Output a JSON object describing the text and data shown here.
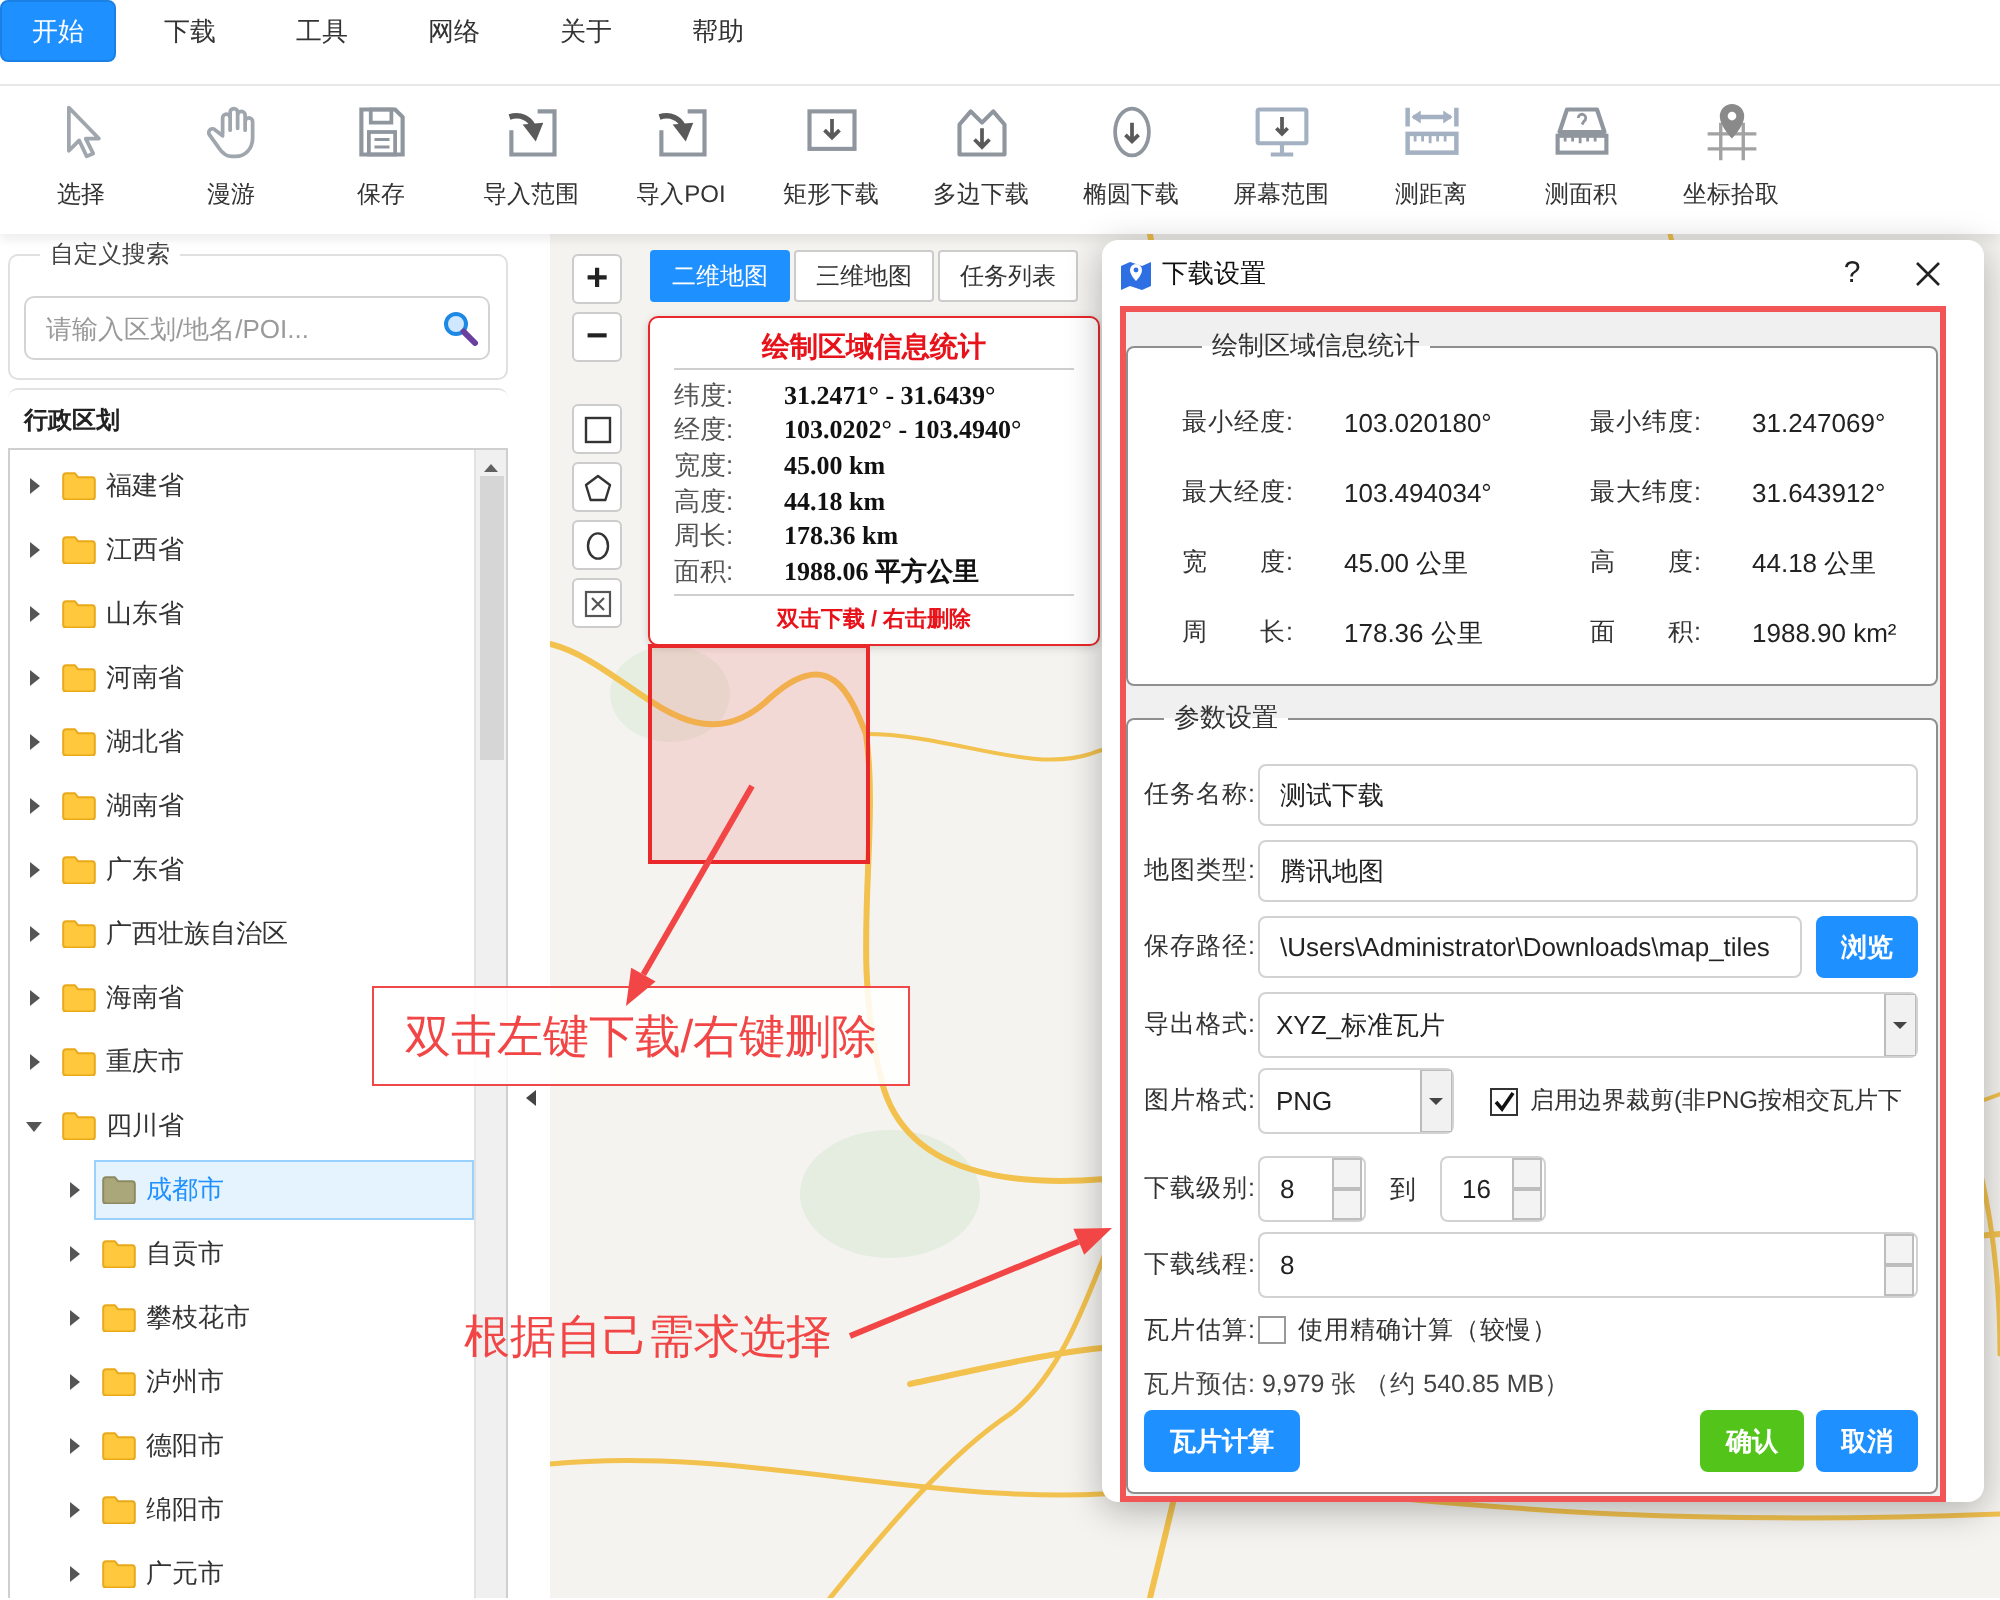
{
  "menu_tabs": [
    {
      "label": "开始",
      "selected": true
    },
    {
      "label": "下载",
      "selected": false
    },
    {
      "label": "工具",
      "selected": false
    },
    {
      "label": "网络",
      "selected": false
    },
    {
      "label": "关于",
      "selected": false
    },
    {
      "label": "帮助",
      "selected": false
    }
  ],
  "toolbar": [
    {
      "kind": "select",
      "label": "选择"
    },
    {
      "kind": "pan",
      "label": "漫游"
    },
    {
      "kind": "save",
      "label": "保存"
    },
    {
      "kind": "import",
      "label": "导入范围"
    },
    {
      "kind": "import",
      "label": "导入POI"
    },
    {
      "kind": "rectangle",
      "label": "矩形下载"
    },
    {
      "kind": "polygon",
      "label": "多边下载"
    },
    {
      "kind": "ellipse",
      "label": "椭圆下载"
    },
    {
      "kind": "screen",
      "label": "屏幕范围"
    },
    {
      "kind": "distance",
      "label": "测距离"
    },
    {
      "kind": "area",
      "label": "测面积"
    },
    {
      "kind": "coordinate",
      "label": "坐标拾取"
    }
  ],
  "sidebar": {
    "search_legend": "自定义搜索",
    "search": {
      "placeholder": "请输入区划/地名/POI..."
    },
    "tree_title": "行政区划",
    "tree": [
      {
        "label": "福建省",
        "expanded": false,
        "selected": false
      },
      {
        "label": "江西省",
        "expanded": false,
        "selected": false
      },
      {
        "label": "山东省",
        "expanded": false,
        "selected": false
      },
      {
        "label": "河南省",
        "expanded": false,
        "selected": false
      },
      {
        "label": "湖北省",
        "expanded": false,
        "selected": false
      },
      {
        "label": "湖南省",
        "expanded": false,
        "selected": false
      },
      {
        "label": "广东省",
        "expanded": false,
        "selected": false
      },
      {
        "label": "广西壮族自治区",
        "expanded": false,
        "selected": false
      },
      {
        "label": "海南省",
        "expanded": false,
        "selected": false
      },
      {
        "label": "重庆市",
        "expanded": false,
        "selected": false
      },
      {
        "label": "四川省",
        "expanded": true,
        "selected": false,
        "children": [
          {
            "label": "成都市",
            "expanded": false,
            "selected": true
          },
          {
            "label": "自贡市",
            "expanded": false,
            "selected": false
          },
          {
            "label": "攀枝花市",
            "expanded": false,
            "selected": false
          },
          {
            "label": "泸州市",
            "expanded": false,
            "selected": false
          },
          {
            "label": "德阳市",
            "expanded": false,
            "selected": false
          },
          {
            "label": "绵阳市",
            "expanded": false,
            "selected": false
          },
          {
            "label": "广元市",
            "expanded": false,
            "selected": false
          }
        ]
      }
    ]
  },
  "map": {
    "zoom_buttons": [
      "+",
      "−"
    ],
    "view_tabs": [
      {
        "label": "二维地图",
        "selected": true
      },
      {
        "label": "三维地图",
        "selected": false
      },
      {
        "label": "任务列表",
        "selected": false
      }
    ],
    "draw_tools": [
      {
        "kind": "rectangle"
      },
      {
        "kind": "polygon"
      },
      {
        "kind": "ellipse"
      },
      {
        "kind": "clear"
      }
    ],
    "info_popup": {
      "title": "绘制区域信息统计",
      "rows": [
        {
          "label": "纬度:",
          "value": "31.2471° - 31.6439°"
        },
        {
          "label": "经度:",
          "value": "103.0202° - 103.4940°"
        },
        {
          "label": "宽度:",
          "value": "45.00 km"
        },
        {
          "label": "高度:",
          "value": "44.18 km"
        },
        {
          "label": "周长:",
          "value": "178.36 km"
        },
        {
          "label": "面积:",
          "value": "1988.06 平方公里"
        }
      ],
      "hint": "双击下载 / 右击删除"
    }
  },
  "dialog": {
    "title": "下载设置",
    "help": "?",
    "stats": {
      "legend": "绘制区域信息统计",
      "items": [
        {
          "label": "最小经度:",
          "value": "103.020180°"
        },
        {
          "label": "最小纬度:",
          "value": "31.247069°"
        },
        {
          "label": "最大经度:",
          "value": "103.494034°"
        },
        {
          "label": "最大纬度:",
          "value": "31.643912°"
        },
        {
          "label": "宽　　度:",
          "value": "45.00 公里"
        },
        {
          "label": "高　　度:",
          "value": "44.18 公里"
        },
        {
          "label": "周　　长:",
          "value": "178.36 公里"
        },
        {
          "label": "面　　积:",
          "value": "1988.90 km²"
        }
      ]
    },
    "params": {
      "legend": "参数设置",
      "rows": [
        {
          "kind": "text",
          "label": "任务名称:",
          "value": "测试下载"
        },
        {
          "kind": "text",
          "label": "地图类型:",
          "value": "腾讯地图"
        },
        {
          "kind": "path",
          "label": "保存路径:",
          "value": "\\Users\\Administrator\\Downloads\\map_tiles",
          "button": "浏览"
        },
        {
          "kind": "select",
          "label": "导出格式:",
          "value": "XYZ_标准瓦片"
        },
        {
          "kind": "select_check",
          "label": "图片格式:",
          "value": "PNG",
          "check": {
            "label": "启用边界裁剪(非PNG按相交瓦片下",
            "checked": true
          }
        },
        {
          "kind": "range",
          "label": "下载级别:",
          "from": "8",
          "separator": "到",
          "to": "16"
        },
        {
          "kind": "spin",
          "label": "下载线程:",
          "value": "8"
        },
        {
          "kind": "check",
          "label": "瓦片估算:",
          "check": {
            "label": "使用精确计算（较慢）",
            "checked": false
          }
        },
        {
          "kind": "note",
          "text": "瓦片预估: 9,979 张 （约 540.85 MB）"
        }
      ]
    },
    "buttons": [
      {
        "kind": "primary",
        "label": "瓦片计算"
      },
      {
        "kind": "success",
        "label": "确认"
      },
      {
        "kind": "primary",
        "label": "取消"
      }
    ]
  },
  "annotations": [
    {
      "kind": "boxed",
      "text": "双击左键下载/右键删除"
    },
    {
      "kind": "plain",
      "text": "根据自己需求选择"
    }
  ]
}
